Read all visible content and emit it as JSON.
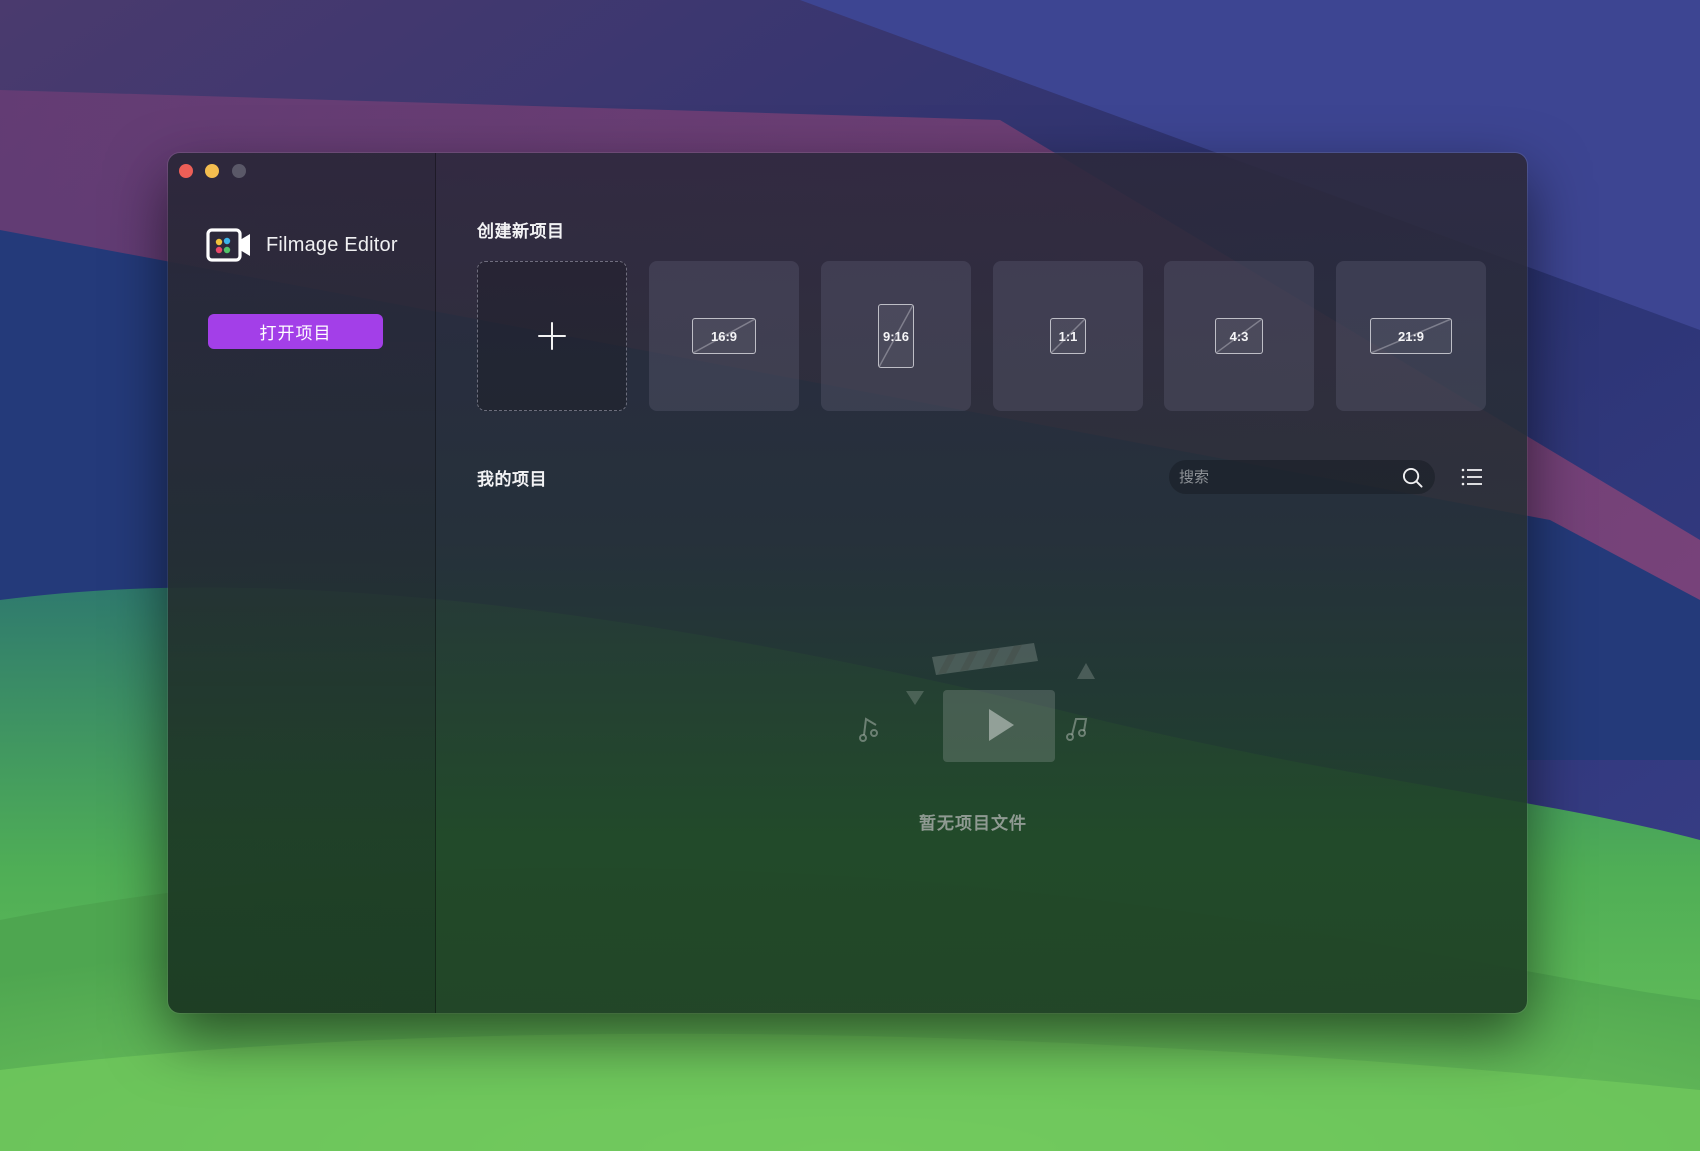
{
  "app": {
    "name": "Filmage Editor",
    "open_project_label": "打开项目"
  },
  "create": {
    "title": "创建新项目",
    "ratios": [
      "16:9",
      "9:16",
      "1:1",
      "4:3",
      "21:9"
    ]
  },
  "projects": {
    "title": "我的项目",
    "search_placeholder": "搜索",
    "empty_text": "暂无项目文件"
  },
  "colors": {
    "accent": "#a33fe8",
    "traffic_close": "#ed5f57",
    "traffic_minimize": "#f4bd4f"
  },
  "icons": [
    "app-logo-icon",
    "plus-icon",
    "search-icon",
    "list-view-icon",
    "clapperboard-illustration"
  ]
}
